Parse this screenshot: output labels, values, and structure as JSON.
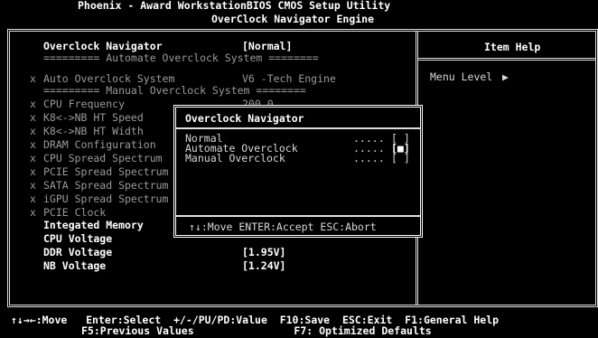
{
  "header": {
    "title": "Phoenix - Award WorkstationBIOS CMOS Setup Utility",
    "subtitle": "OverClock Navigator Engine"
  },
  "main": {
    "items": [
      {
        "marker": "",
        "label": "Overclock Navigator",
        "value": "[Normal]",
        "disabled": false
      },
      {
        "marker": "",
        "label": "========= Automate Overclock System ========",
        "value": "",
        "disabled": true
      },
      {
        "marker": "x",
        "label": "Auto Overclock System",
        "value": "V6 -Tech Engine",
        "disabled": true
      },
      {
        "marker": "",
        "label": "========= Manual Overclock System ========",
        "value": "",
        "disabled": true
      },
      {
        "marker": "x",
        "label": "CPU Frequency",
        "value": "200.0",
        "disabled": true
      },
      {
        "marker": "x",
        "label": "K8<->NB HT Speed",
        "value": "",
        "disabled": true
      },
      {
        "marker": "x",
        "label": "K8<->NB HT Width",
        "value": "",
        "disabled": true
      },
      {
        "marker": "x",
        "label": "DRAM Configuration",
        "value": "",
        "disabled": true
      },
      {
        "marker": "x",
        "label": "CPU Spread Spectrum",
        "value": "",
        "disabled": true
      },
      {
        "marker": "x",
        "label": "PCIE Spread Spectrum",
        "value": "",
        "disabled": true
      },
      {
        "marker": "x",
        "label": "SATA Spread Spectrum",
        "value": "",
        "disabled": true
      },
      {
        "marker": "x",
        "label": "iGPU Spread Spectrum",
        "value": "",
        "disabled": true
      },
      {
        "marker": "x",
        "label": "PCIE Clock",
        "value": "",
        "disabled": true
      },
      {
        "marker": "",
        "label": "Integated Memory",
        "value": "",
        "disabled": false
      },
      {
        "marker": "",
        "label": "CPU Voltage",
        "value": "",
        "disabled": false
      },
      {
        "marker": "",
        "label": "DDR Voltage",
        "value": "[1.95V]",
        "disabled": false
      },
      {
        "marker": "",
        "label": "NB Voltage",
        "value": "[1.24V]",
        "disabled": false
      }
    ]
  },
  "help": {
    "title": "Item Help",
    "menu_level_label": "Menu Level",
    "menu_level_arrow": "▶"
  },
  "popup": {
    "title": "Overclock Navigator",
    "options": [
      {
        "label": "Normal",
        "dots": ".....",
        "mark": "[ ]"
      },
      {
        "label": "Automate Overclock",
        "dots": ".....",
        "mark": "[■]"
      },
      {
        "label": "Manual Overclock",
        "dots": ".....",
        "mark": "[ ]"
      }
    ],
    "footer": "↑↓:Move ENTER:Accept ESC:Abort"
  },
  "footer": {
    "line1": "↑↓→←:Move   Enter:Select  +/-/PU/PD:Value  F10:Save  ESC:Exit  F1:General Help",
    "line2": "F5:Previous Values                F7: Optimized Defaults"
  }
}
